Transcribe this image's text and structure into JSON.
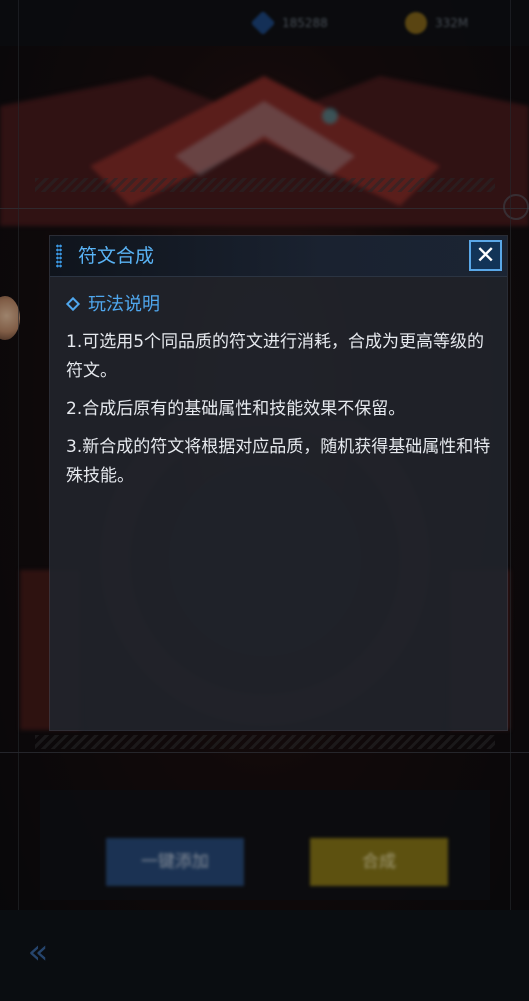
{
  "resources": {
    "gem": {
      "icon": "gem-icon",
      "value": "185288"
    },
    "gold": {
      "icon": "gold-coin-icon",
      "value": "332M"
    }
  },
  "dialog": {
    "title": "符文合成",
    "close_icon": "close-icon",
    "section_title": "玩法说明",
    "rules": [
      "1.可选用5个同品质的符文进行消耗，合成为更高等级的符文。",
      "2.合成后原有的基础属性和技能效果不保留。",
      "3.新合成的符文将根据对应品质，随机获得基础属性和特殊技能。"
    ]
  },
  "background_buttons": {
    "auto_add_label": "一键添加",
    "compose_label": "合成",
    "back_icon": "double-chevron-left-icon"
  },
  "colors": {
    "accent_blue": "#59b3f5",
    "close_border": "#5aa8e8",
    "dialog_bg": "#20242b",
    "rule_text": "#e6e9ee",
    "compose_button": "#8f7d1a",
    "auto_add_button": "#2a4e80"
  }
}
